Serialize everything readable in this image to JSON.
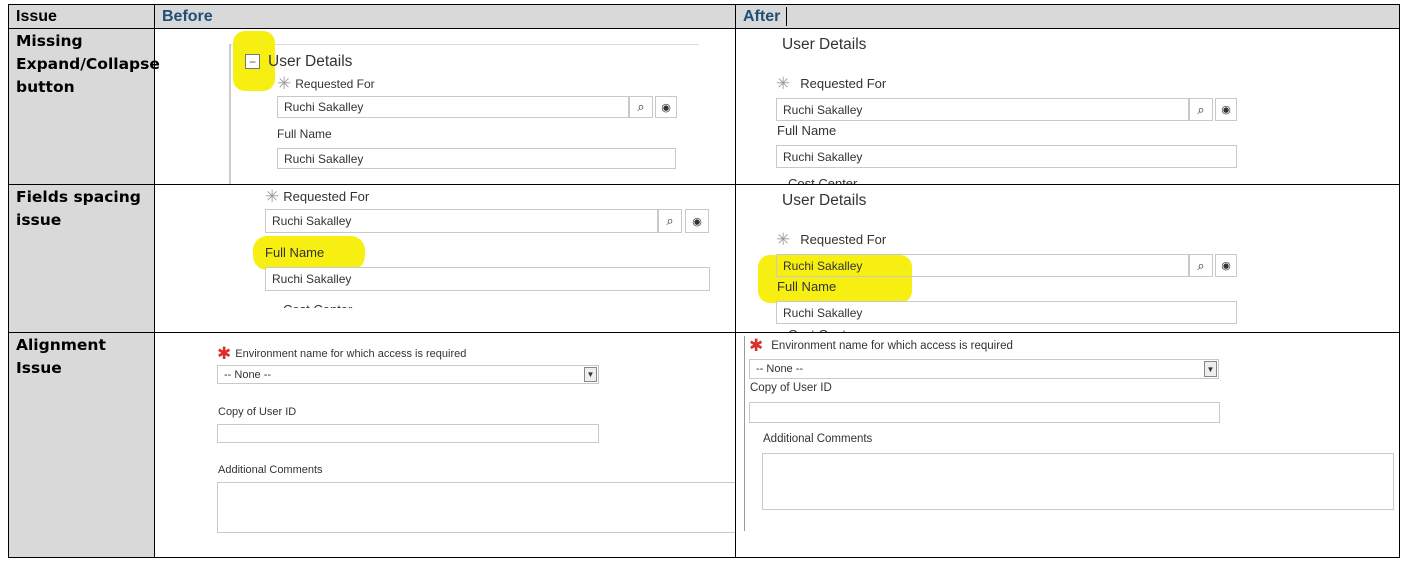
{
  "table": {
    "headers": {
      "issue": "Issue",
      "before": "Before",
      "after": "After"
    },
    "rows": [
      {
        "issue": "Missing Expand/Collapse button"
      },
      {
        "issue": "Fields spacing issue"
      },
      {
        "issue": "Alignment Issue"
      }
    ]
  },
  "form": {
    "section_title": "User Details",
    "requested_for_label": "Requested For",
    "requested_for_value": "Ruchi Sakalley",
    "full_name_label": "Full Name",
    "full_name_value": "Ruchi Sakalley",
    "cut_off_label": "Cost Center",
    "env_label": "Environment name for which access is required",
    "env_value": "-- None --",
    "copy_user_label": "Copy of User ID",
    "comments_label": "Additional Comments"
  },
  "colors": {
    "highlight": "#f7ef12",
    "header_bg": "#d9d9d9",
    "header_text": "#1f4e79"
  }
}
